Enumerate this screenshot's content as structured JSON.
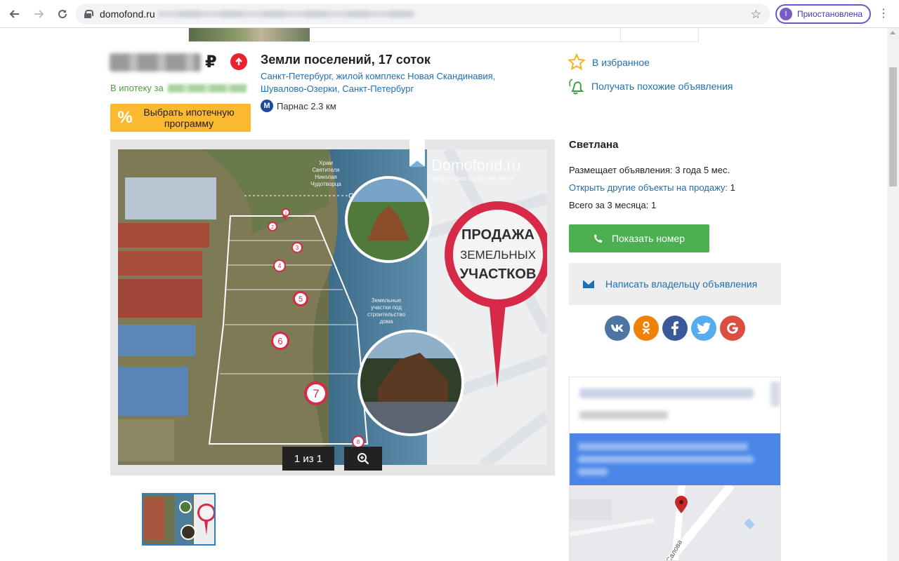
{
  "browser": {
    "url": "domofond.ru",
    "profile_initial": "I",
    "profile_label": "Приостановлена",
    "icons": [
      "back-arrow-icon",
      "forward-arrow-icon",
      "reload-icon",
      "lock-icon",
      "bookmark-star-icon",
      "menu-dots-icon"
    ]
  },
  "listing": {
    "price_currency": "₽",
    "mortgage_prefix": "В ипотеку за",
    "mortgage_button_icon": "%",
    "mortgage_button_label": "Выбрать ипотечную программу",
    "title": "Земли поселений, 17 соток",
    "address": "Санкт-Петербург, жилой комплекс Новая Скандинавия, Шувалово-Озерки, Санкт-Петербург",
    "metro_icon": "М",
    "metro": "Парнас 2.3 км"
  },
  "actions": {
    "favorite": "В избранное",
    "similar": "Получать похожие объявления"
  },
  "gallery": {
    "counter": "1 из 1",
    "watermark": "Domofond.ru",
    "watermark_sub": "найдите свое идеальное жилье",
    "sign_lines": [
      "ПРОДАЖА",
      "ЗЕМЕЛЬНЫХ",
      "УЧАСТКОВ"
    ],
    "temple_label": [
      "Храм",
      "Святителя",
      "Николая",
      "Чудотворца"
    ],
    "plots_label": [
      "Земельные",
      "участки под",
      "строительство",
      "дома"
    ],
    "markers": [
      "1",
      "2",
      "3",
      "4",
      "5",
      "6",
      "7",
      "8"
    ]
  },
  "seller": {
    "name": "Светлана",
    "posting_label": "Размещает объявления: 3 года 5 мес.",
    "other_link": "Открыть другие объекты на продажу:",
    "other_count": "1",
    "total_label": "Всего за 3 месяца: 1",
    "phone_button": "Показать номер",
    "write_button": "Написать владельцу объявления"
  },
  "socials": [
    {
      "label": "vk",
      "color": "#4c75a3"
    },
    {
      "label": "ok",
      "color": "#ee8208"
    },
    {
      "label": "f",
      "color": "#3b5998"
    },
    {
      "label": "tw",
      "color": "#55acee"
    },
    {
      "label": "G",
      "color": "#dc4e41"
    }
  ],
  "map": {
    "street_label": "Салова"
  }
}
